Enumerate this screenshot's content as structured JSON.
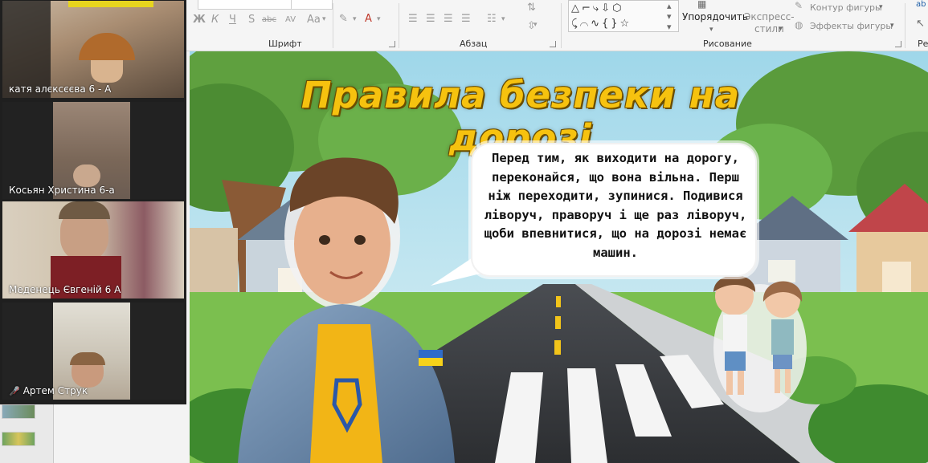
{
  "participants": [
    {
      "name": "катя алєксєєва 6 - А",
      "muted": false
    },
    {
      "name": "Косьян Христина 6-а",
      "muted": false
    },
    {
      "name": "Меденець Євгеній 6 А",
      "muted": false
    },
    {
      "name": "Артем Струк",
      "muted": true
    }
  ],
  "ribbon": {
    "font_group": "Шрифт",
    "paragraph_group": "Абзац",
    "drawing_group": "Рисование",
    "format_buttons": [
      "Ж",
      "К",
      "Ч",
      "S",
      "abc",
      "AV",
      "Aa"
    ],
    "arrange_label": "Упорядочить",
    "quick_styles_line1": "Экспресс-",
    "quick_styles_line2": "стили",
    "shape_outline": "Контур фигуры",
    "shape_effects": "Эффекты фигуры",
    "edit_cut": "Ред"
  },
  "slide": {
    "title": "Правила безпеки на дорозі",
    "bubble_text": "Перед тим, як виходити на дорогу, переконайся, що вона вільна. Перш ніж переходити, зупинися. Подивися ліворуч, праворуч і ще раз ліворуч, щоби впевнитися, що на дорозі немає машин."
  },
  "colors": {
    "title_yellow": "#f6c20f",
    "mic_muted": "#e5393b",
    "ribbon_bg": "#f5f5f5"
  }
}
